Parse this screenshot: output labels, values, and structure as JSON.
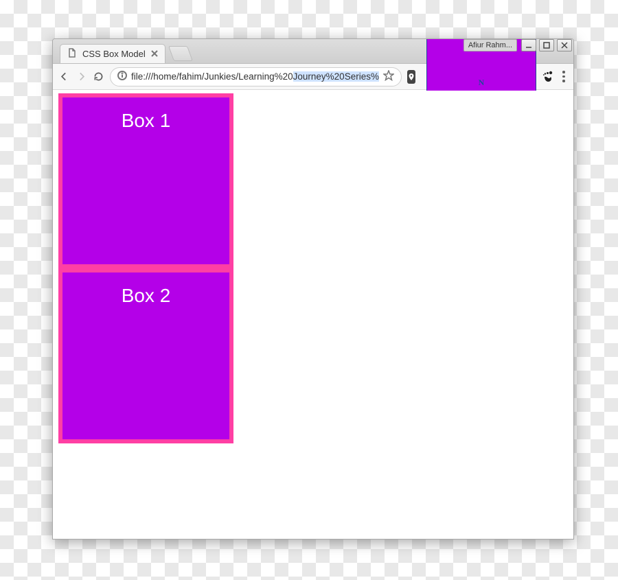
{
  "os_title": "Afiur Rahm...",
  "tab": {
    "title": "CSS Box Model"
  },
  "address": {
    "prefix": "file:///home/fahim/Junkies/Learning%20",
    "highlight": "Journey%20Series%",
    "suffix": ""
  },
  "extensions": {
    "letter": "N"
  },
  "page": {
    "boxes": [
      "Box 1",
      "Box 2"
    ]
  }
}
